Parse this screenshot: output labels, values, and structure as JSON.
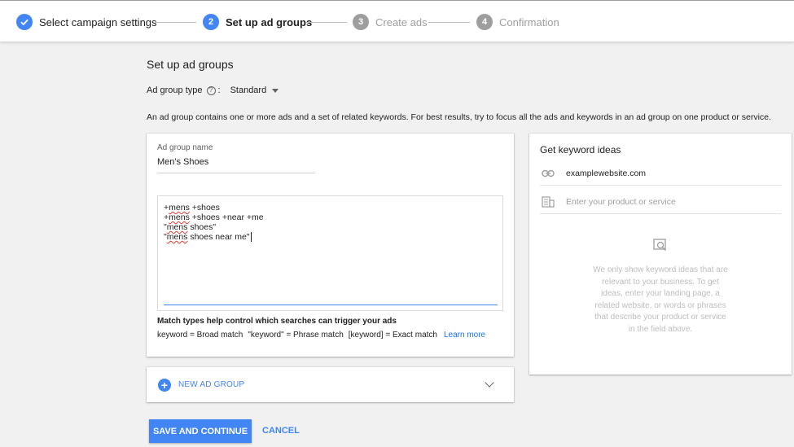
{
  "stepper": {
    "steps": [
      {
        "number": "",
        "label": "Select campaign settings",
        "state": "done"
      },
      {
        "number": "2",
        "label": "Set up ad groups",
        "state": "active"
      },
      {
        "number": "3",
        "label": "Create ads",
        "state": "pending"
      },
      {
        "number": "4",
        "label": "Confirmation",
        "state": "pending"
      }
    ]
  },
  "page": {
    "title": "Set up ad groups",
    "ad_group_type_label": "Ad group type",
    "help_glyph": "?",
    "colon": ":",
    "ad_group_type_value": "Standard",
    "description": "An ad group contains one or more ads and a set of related keywords. For best results, try to focus all the ads and keywords in an ad group on one product or service."
  },
  "ad_group": {
    "name_label": "Ad group name",
    "name_value": "Men's Shoes",
    "keywords": [
      [
        "",
        "+",
        "mens",
        " +shoes"
      ],
      [
        "",
        "+",
        "mens",
        " +shoes +near +me"
      ],
      [
        "",
        "\"",
        "mens",
        " shoes\""
      ],
      [
        "",
        "\"",
        "mens",
        " shoes near me\""
      ]
    ],
    "match_title": "Match types help control which searches can trigger your ads",
    "match_broad": "keyword = Broad match",
    "match_phrase": "\"keyword\" = Phrase match",
    "match_exact": "[keyword] = Exact match",
    "learn_more": "Learn more"
  },
  "new_ad_group": {
    "icon": "+",
    "label": "NEW AD GROUP"
  },
  "actions": {
    "save_label": "SAVE AND CONTINUE",
    "cancel_label": "CANCEL"
  },
  "keyword_ideas": {
    "title": "Get keyword ideas",
    "website_value": "examplewebsite.com",
    "product_placeholder": "Enter your product or service",
    "empty_message": "We only show keyword ideas that are relevant to your business. To get ideas, enter your landing page, a related website, or words or phrases that describe your product or service in the field above."
  },
  "colors": {
    "accent": "#4285f4",
    "pending": "#9e9e9e",
    "background": "#f1f1f1"
  },
  "icons": [
    "check-icon",
    "help-icon",
    "dropdown-caret-icon",
    "plus-circle-icon",
    "chevron-down-icon",
    "link-icon",
    "product-grid-icon",
    "search-document-icon"
  ]
}
